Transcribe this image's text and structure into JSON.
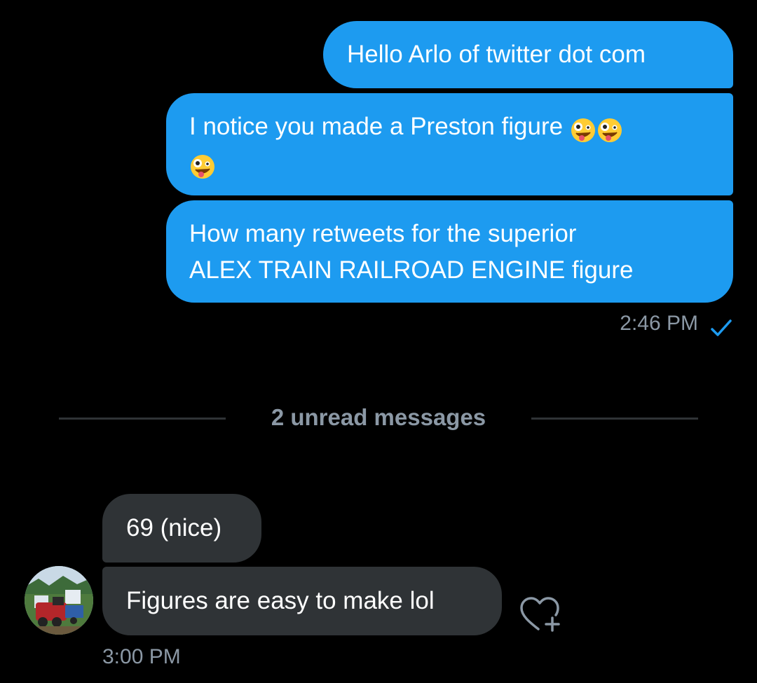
{
  "conversation": {
    "sent_messages": [
      {
        "text": "Hello Arlo of twitter dot com"
      },
      {
        "text": "I notice you made a Preston figure",
        "emoji": "🤪🤪🤪"
      },
      {
        "text_line1": "How many retweets for the superior",
        "text_line2": "ALEX TRAIN RAILROAD ENGINE figure"
      }
    ],
    "sent_timestamp": "2:46 PM",
    "unread_divider": "2 unread messages",
    "received_messages": [
      {
        "text": "69 (nice)"
      },
      {
        "text": "Figures are easy to make lol"
      }
    ],
    "received_timestamp": "3:00 PM"
  },
  "icons": {
    "read_status": "check-icon",
    "react": "heart-plus-icon",
    "avatar": "train-avatar"
  },
  "colors": {
    "sent_bubble": "#1d9bf0",
    "received_bubble": "#2f3336",
    "background": "#000000",
    "secondary_text": "#8b98a5"
  }
}
